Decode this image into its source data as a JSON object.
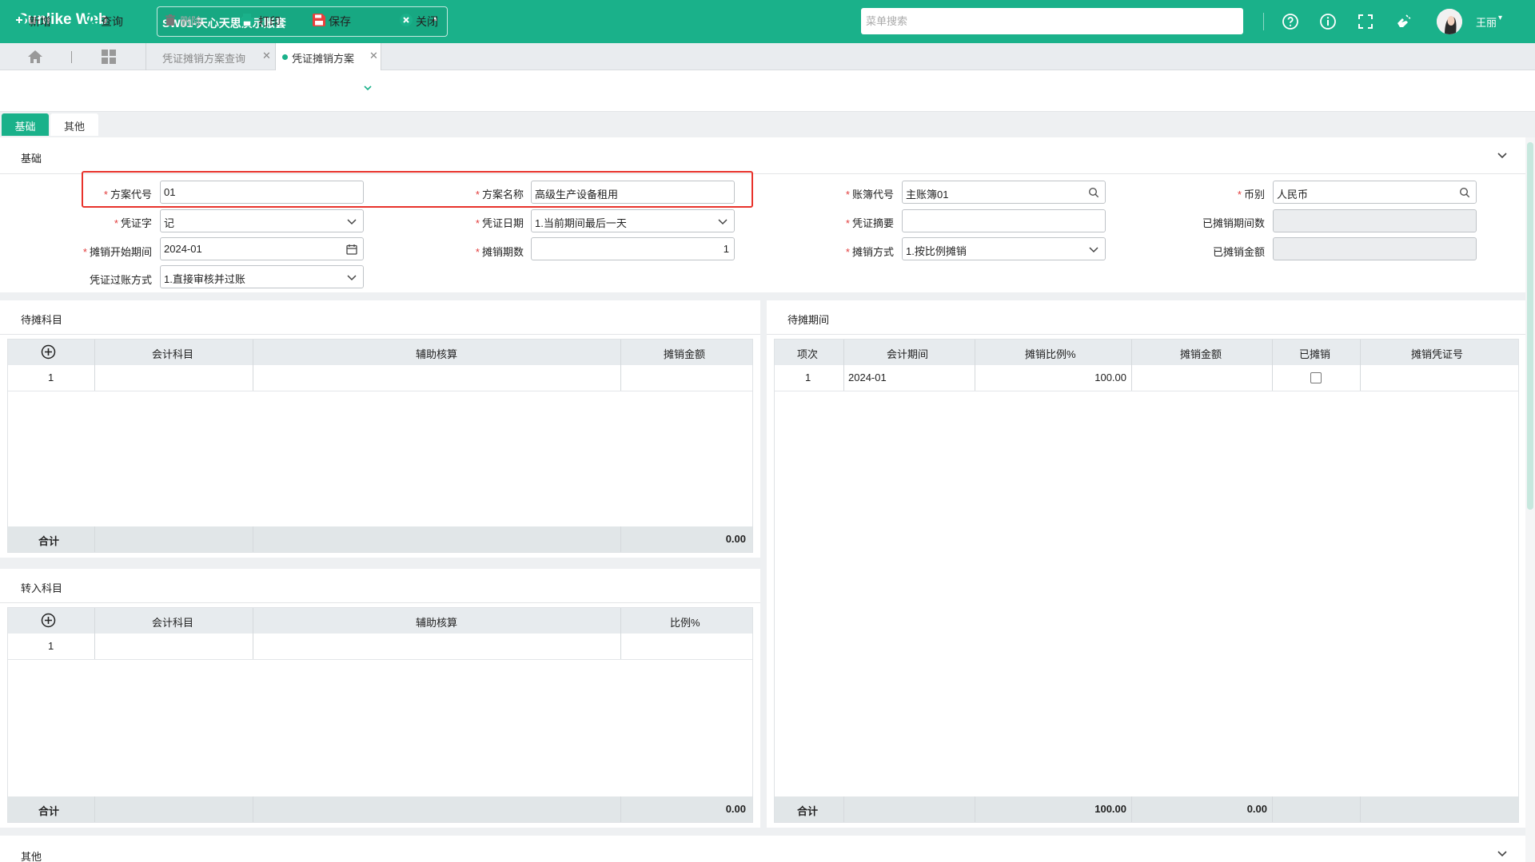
{
  "header": {
    "logo": "Sunlike Web",
    "account": "SW01-天心天思演示账套",
    "search_placeholder": "菜单搜索",
    "user_name": "王丽",
    "colors": {
      "brand": "#1ab18a",
      "highlight": "#e8322b"
    }
  },
  "tabs": [
    {
      "label": "凭证摊销方案查询",
      "active": false
    },
    {
      "label": "凭证摊销方案",
      "active": true
    }
  ],
  "toolbar": {
    "new": "新增",
    "query": "查询",
    "delete": "删除",
    "print": "打印",
    "save": "保存",
    "close": "关闭"
  },
  "form_tabs": [
    "基础",
    "其他"
  ],
  "section": {
    "title": "基础"
  },
  "form": {
    "plan_code": {
      "label": "方案代号",
      "value": "01"
    },
    "plan_name": {
      "label": "方案名称",
      "value": "高级生产设备租用"
    },
    "ledger_code": {
      "label": "账簿代号",
      "value": "主账簿01"
    },
    "currency": {
      "label": "币别",
      "value": "人民币"
    },
    "voucher_type": {
      "label": "凭证字",
      "value": "记"
    },
    "voucher_date": {
      "label": "凭证日期",
      "value": "1.当前期间最后一天"
    },
    "voucher_summary": {
      "label": "凭证摘要",
      "value": ""
    },
    "amortized_periods": {
      "label": "已摊销期间数",
      "value": ""
    },
    "start_period": {
      "label": "摊销开始期间",
      "value": "2024-01"
    },
    "period_count": {
      "label": "摊销期数",
      "value": "1"
    },
    "method": {
      "label": "摊销方式",
      "value": "1.按比例摊销"
    },
    "amortized_amount": {
      "label": "已摊销金额",
      "value": ""
    },
    "posting_mode": {
      "label": "凭证过账方式",
      "value": "1.直接审核并过账"
    }
  },
  "pending_subjects": {
    "title": "待摊科目",
    "columns": [
      "会计科目",
      "辅助核算",
      "摊销金额"
    ],
    "rows": [
      {
        "no": "1",
        "subject": "",
        "aux": "",
        "amount": ""
      }
    ],
    "total_label": "合计",
    "total_amount": "0.00"
  },
  "transfer_subjects": {
    "title": "转入科目",
    "columns": [
      "会计科目",
      "辅助核算",
      "比例%"
    ],
    "rows": [
      {
        "no": "1",
        "subject": "",
        "aux": "",
        "ratio": ""
      }
    ],
    "total_label": "合计",
    "total_amount": "0.00"
  },
  "pending_periods": {
    "title": "待摊期间",
    "columns": [
      "项次",
      "会计期间",
      "摊销比例%",
      "摊销金额",
      "已摊销",
      "摊销凭证号"
    ],
    "rows": [
      {
        "no": "1",
        "period": "2024-01",
        "ratio": "100.00",
        "amount": "",
        "done": false,
        "voucher_no": ""
      }
    ],
    "total_label": "合计",
    "total_ratio": "100.00",
    "total_amount": "0.00"
  },
  "bottom_section": {
    "title": "其他"
  }
}
